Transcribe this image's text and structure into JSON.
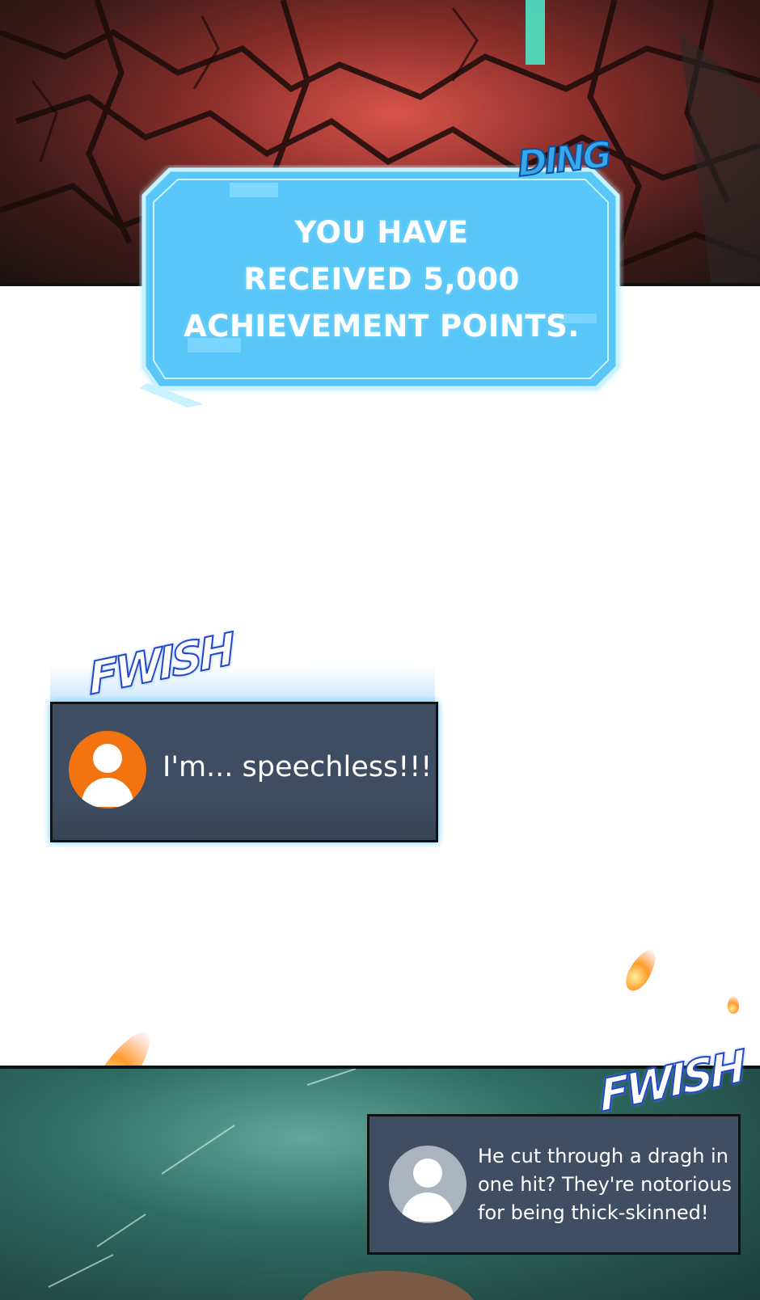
{
  "system_message": {
    "lines": [
      "YOU HAVE",
      "RECEIVED 5,000",
      "ACHIEVEMENT POINTS."
    ],
    "sfx": "DING"
  },
  "chat_messages": [
    {
      "sfx": "FWISH",
      "text": "I'm... speechless!!!",
      "avatar_color": "#f2730f"
    },
    {
      "sfx": "FWISH",
      "text_lines": [
        "He cut through a dragh in",
        "one hit? They're notorious",
        "for being thick-skinned!"
      ],
      "avatar_color": "#a9b4bf"
    }
  ],
  "colors": {
    "system_box": "#58c6f7",
    "chat_box": "#3f4e62"
  }
}
